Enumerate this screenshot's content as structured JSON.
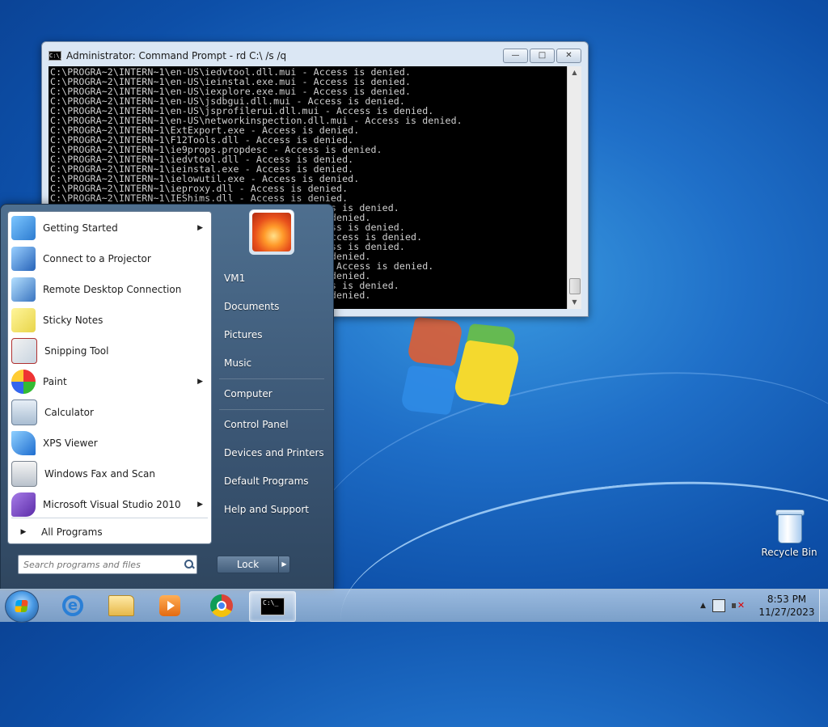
{
  "cmd": {
    "title": "Administrator:  Command Prompt - rd  C:\\ /s /q",
    "icon_label": "C:\\_",
    "buttons": {
      "minimize": "—",
      "maximize": "□",
      "close": "✕"
    },
    "lines": [
      "C:\\PROGRA~2\\INTERN~1\\en-US\\iedvtool.dll.mui - Access is denied.",
      "C:\\PROGRA~2\\INTERN~1\\en-US\\ieinstal.exe.mui - Access is denied.",
      "C:\\PROGRA~2\\INTERN~1\\en-US\\iexplore.exe.mui - Access is denied.",
      "C:\\PROGRA~2\\INTERN~1\\en-US\\jsdbgui.dll.mui - Access is denied.",
      "C:\\PROGRA~2\\INTERN~1\\en-US\\jsprofilerui.dll.mui - Access is denied.",
      "C:\\PROGRA~2\\INTERN~1\\en-US\\networkinspection.dll.mui - Access is denied.",
      "C:\\PROGRA~2\\INTERN~1\\ExtExport.exe - Access is denied.",
      "C:\\PROGRA~2\\INTERN~1\\F12Tools.dll - Access is denied.",
      "C:\\PROGRA~2\\INTERN~1\\ie9props.propdesc - Access is denied.",
      "C:\\PROGRA~2\\INTERN~1\\iedvtool.dll - Access is denied.",
      "C:\\PROGRA~2\\INTERN~1\\ieinstal.exe - Access is denied.",
      "C:\\PROGRA~2\\INTERN~1\\ielowutil.exe - Access is denied.",
      "C:\\PROGRA~2\\INTERN~1\\ieproxy.dll - Access is denied.",
      "C:\\PROGRA~2\\INTERN~1\\IEShims.dll - Access is denied.",
      "                                                 s is denied.",
      "                                                 denied.",
      "                                                 ss is denied.",
      "                                                 ccess is denied.",
      "                                                 ss is denied.",
      "                                                 denied.",
      "                                                  Access is denied.",
      "                                                 denied.",
      "                                                 s is denied.",
      "                                                 denied."
    ]
  },
  "start_menu": {
    "programs": [
      {
        "label": "Getting Started",
        "icon": "getting-started-icon",
        "submenu": true
      },
      {
        "label": "Connect to a Projector",
        "icon": "projector-icon",
        "submenu": false
      },
      {
        "label": "Remote Desktop Connection",
        "icon": "remote-desktop-icon",
        "submenu": false
      },
      {
        "label": "Sticky Notes",
        "icon": "sticky-notes-icon",
        "submenu": false
      },
      {
        "label": "Snipping Tool",
        "icon": "snipping-tool-icon",
        "submenu": false
      },
      {
        "label": "Paint",
        "icon": "paint-icon",
        "submenu": true
      },
      {
        "label": "Calculator",
        "icon": "calculator-icon",
        "submenu": false
      },
      {
        "label": "XPS Viewer",
        "icon": "xps-viewer-icon",
        "submenu": false
      },
      {
        "label": "Windows Fax and Scan",
        "icon": "fax-scan-icon",
        "submenu": false
      },
      {
        "label": "Microsoft Visual Studio 2010",
        "icon": "visual-studio-icon",
        "submenu": true
      }
    ],
    "all_programs": "All Programs",
    "search_placeholder": "Search programs and files",
    "right": {
      "user": "VM1",
      "documents": "Documents",
      "pictures": "Pictures",
      "music": "Music",
      "computer": "Computer",
      "control_panel": "Control Panel",
      "devices": "Devices and Printers",
      "default_programs": "Default Programs",
      "help": "Help and Support"
    },
    "lock_label": "Lock",
    "arrow": "▶"
  },
  "desktop": {
    "recycle_bin": "Recycle Bin"
  },
  "taskbar": {
    "time": "8:53 PM",
    "date": "11/27/2023",
    "tray_arrow": "▲",
    "cmd_icon_text": "C:\\_"
  },
  "colors": {
    "accent": "#1f6fc8",
    "console_bg": "#000000",
    "console_fg": "#d0d0d0"
  }
}
